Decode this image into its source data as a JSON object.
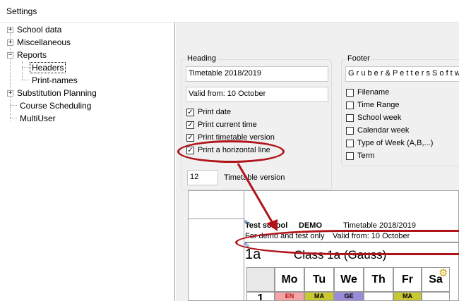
{
  "window": {
    "title": "Settings"
  },
  "tree": {
    "items": [
      {
        "label": "School data",
        "expander": "+",
        "level": 0
      },
      {
        "label": "Miscellaneous",
        "expander": "+",
        "level": 0
      },
      {
        "label": "Reports",
        "expander": "−",
        "level": 0
      },
      {
        "label": "Headers",
        "level": 1,
        "selected": true
      },
      {
        "label": "Print-names",
        "level": 1
      },
      {
        "label": "Substitution Planning",
        "expander": "+",
        "level": 0
      },
      {
        "label": "Course Scheduling",
        "level": 0
      },
      {
        "label": "MultiUser",
        "level": 0
      }
    ]
  },
  "heading": {
    "title": "Heading",
    "line1": "Timetable 2018/2019",
    "line2": "Valid from: 10 October",
    "checks": [
      {
        "label": "Print date",
        "checked": true
      },
      {
        "label": "Print current time",
        "checked": true
      },
      {
        "label": "Print timetable version",
        "checked": true
      },
      {
        "label": "Print a horizontal line",
        "checked": true
      }
    ],
    "version_value": "12",
    "version_label": "Timetable version"
  },
  "footer": {
    "title": "Footer",
    "text": "G r u b e r  &  P e t t e r s  S o f t w",
    "checks": [
      {
        "label": "Filename",
        "checked": false
      },
      {
        "label": "Time Range",
        "checked": false
      },
      {
        "label": "School week",
        "checked": false
      },
      {
        "label": "Calendar week",
        "checked": false
      },
      {
        "label": "Type of Week (A,B,...)",
        "checked": false
      },
      {
        "label": "Term",
        "checked": false
      }
    ]
  },
  "preview": {
    "school": "Test school",
    "demo": "DEMO",
    "timetable": "Timetable 2018/2019",
    "sub": "For demo and test only",
    "valid": "Valid from: 10 October",
    "class_code": "1a",
    "class_name": "Class 1a (Gauss)",
    "days": [
      "Mo",
      "Tu",
      "We",
      "Th",
      "Fr",
      "Sa"
    ],
    "row1": "1",
    "cells": [
      "EN",
      "MA",
      "GE",
      "",
      "MA",
      ""
    ],
    "colors": {
      "accent": "#b0141a",
      "mo": "#f4a6a6",
      "tu": "#c8c832",
      "we": "#9a8ad8",
      "fr": "#c8c832"
    }
  },
  "checkmark": "✓"
}
